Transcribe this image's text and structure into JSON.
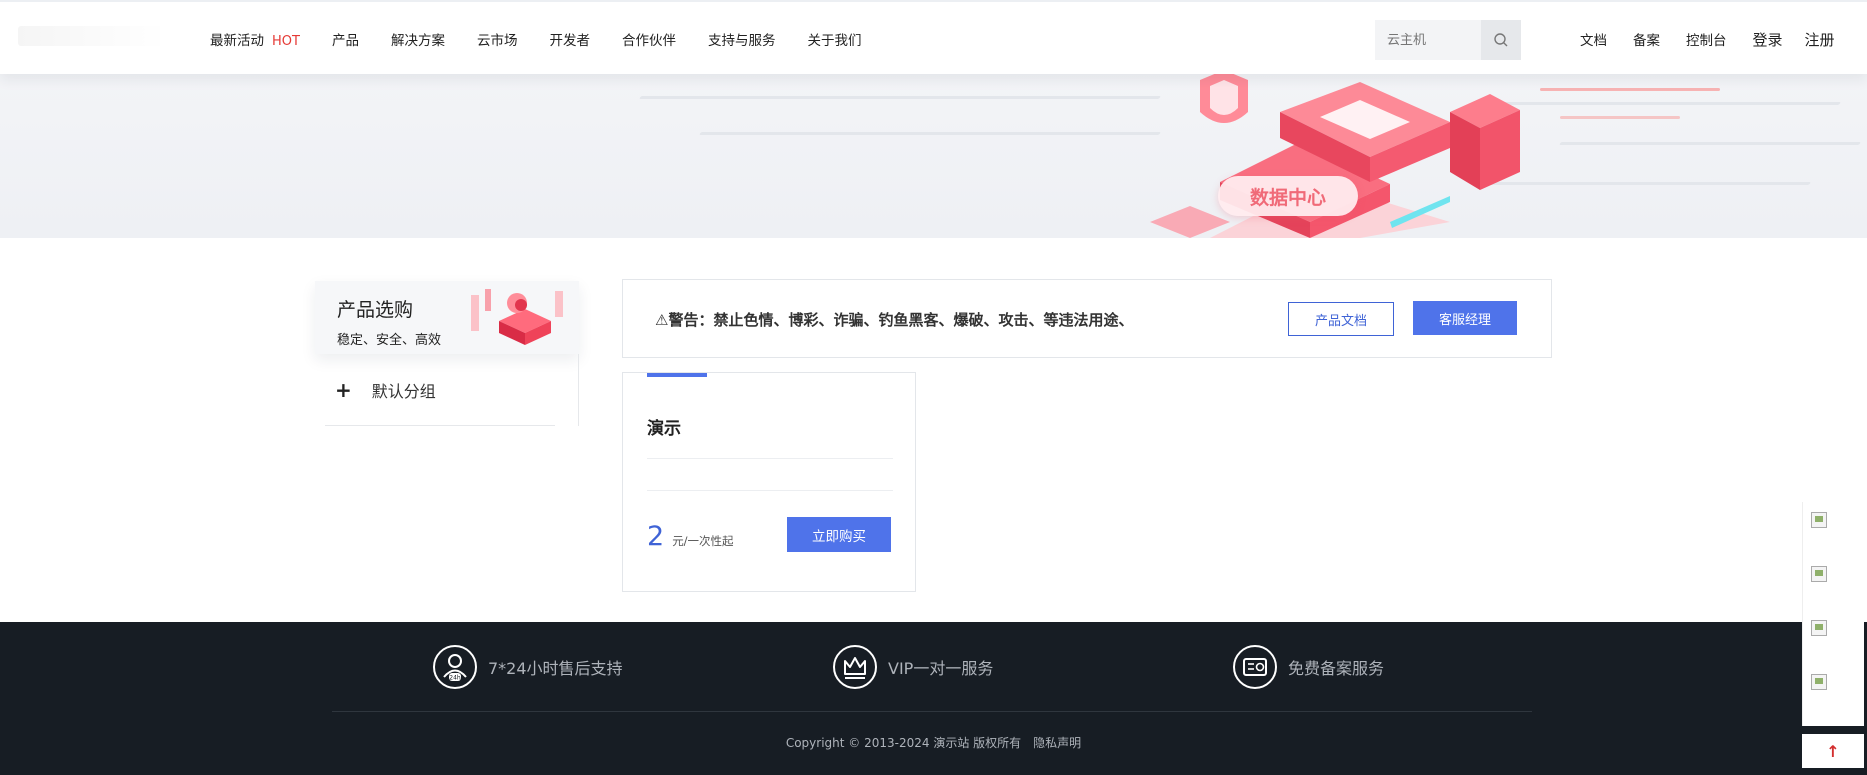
{
  "header": {
    "nav": [
      {
        "label": "最新活动",
        "badge": "HOT"
      },
      {
        "label": "产品"
      },
      {
        "label": "解决方案"
      },
      {
        "label": "云市场"
      },
      {
        "label": "开发者"
      },
      {
        "label": "合作伙伴"
      },
      {
        "label": "支持与服务"
      },
      {
        "label": "关于我们"
      }
    ],
    "search": {
      "placeholder": "云主机",
      "icon": "search-icon"
    },
    "links": {
      "docs": "文档",
      "beian": "备案",
      "console": "控制台",
      "login": "登录",
      "register": "注册"
    }
  },
  "banner": {
    "label": "数据中心"
  },
  "sidebar": {
    "title": "产品选购",
    "subtitle": "稳定、安全、高效",
    "groups": [
      {
        "label": "默认分组",
        "icon": "plus-icon"
      }
    ]
  },
  "notice": {
    "text": "⚠警告：禁止色情、博彩、诈骗、钓鱼黑客、爆破、攻击、等违法用途、",
    "doc_button": "产品文档",
    "service_button": "客服经理"
  },
  "product": {
    "name": "演示",
    "price": "2",
    "unit": "元/一次性起",
    "buy_button": "立即购买"
  },
  "footer": {
    "features": [
      {
        "label": "7*24小时售后支持",
        "icon": "support-24h-icon"
      },
      {
        "label": "VIP一对一服务",
        "icon": "crown-icon"
      },
      {
        "label": "免费备案服务",
        "icon": "certificate-icon"
      }
    ],
    "copyright": "Copyright © 2013-2024 演示站 版权所有",
    "privacy": "隐私声明"
  },
  "colors": {
    "accent": "#4f73ea",
    "hot": "#e53935",
    "footer_bg": "#171d24"
  }
}
